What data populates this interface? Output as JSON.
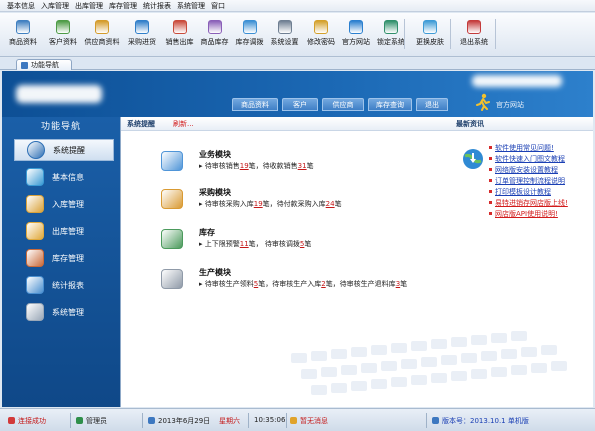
{
  "menubar": {
    "items": [
      "基本信息",
      "入库管理",
      "出库管理",
      "库存管理",
      "统计报表",
      "系统管理",
      "窗口"
    ]
  },
  "toolbar": {
    "buttons": [
      {
        "label": "商品资料",
        "icon": "goods-icon",
        "color": "#3f7fc0"
      },
      {
        "label": "客户资料",
        "icon": "customer-icon",
        "color": "#4d9b45"
      },
      {
        "label": "供应商资料",
        "icon": "supplier-icon",
        "color": "#d49b2a"
      },
      {
        "label": "采购进货",
        "icon": "purchase-icon",
        "color": "#2f7ec9"
      },
      {
        "label": "销售出库",
        "icon": "sales-icon",
        "color": "#c94a3a"
      },
      {
        "label": "商品库存",
        "icon": "inventory-icon",
        "color": "#8a5fb8"
      },
      {
        "label": "库存调拨",
        "icon": "transfer-icon",
        "color": "#3b8fd4"
      },
      {
        "label": "系统设置",
        "icon": "settings-icon",
        "color": "#6f7f92"
      },
      {
        "label": "修改密码",
        "icon": "password-icon",
        "color": "#d4a02a"
      },
      {
        "label": "官方网站",
        "icon": "website-icon",
        "color": "#2a7fcf"
      },
      {
        "label": "锁定系统",
        "icon": "lock-icon",
        "color": "#2f8f6a"
      },
      {
        "label": "更换皮肤",
        "icon": "skin-icon",
        "color": "#3e9bd6"
      },
      {
        "label": "退出系统",
        "icon": "exit-icon",
        "color": "#c43b3b"
      }
    ]
  },
  "tabstrip": {
    "tab_label": "功能导航"
  },
  "header": {
    "nav": [
      "商品资料",
      "客户",
      "供应商",
      "库存查询",
      "退出"
    ],
    "website_label": "官方网站"
  },
  "sidebar": {
    "title": "功能导航",
    "items": [
      {
        "label": "系统提醒",
        "icon": "info-icon",
        "color": "#2d6fb5",
        "active": true
      },
      {
        "label": "基本信息",
        "icon": "blocks-icon",
        "color": "#3a9ad4"
      },
      {
        "label": "入库管理",
        "icon": "box-in-icon",
        "color": "#d9a23a"
      },
      {
        "label": "出库管理",
        "icon": "box-out-icon",
        "color": "#e0a93c"
      },
      {
        "label": "库存管理",
        "icon": "warehouse-icon",
        "color": "#c96a3a"
      },
      {
        "label": "统计报表",
        "icon": "report-icon",
        "color": "#4a8fd0"
      },
      {
        "label": "系统管理",
        "icon": "gears-icon",
        "color": "#9aa8b8"
      }
    ]
  },
  "content": {
    "bar_tab": "系统提醒",
    "bar_link": "刷新...",
    "news_title": "最新资讯",
    "modules": [
      {
        "title": "业务模块",
        "icon": "notebook-icon",
        "color": "#4f95d8",
        "parts": [
          {
            "t": "待审核销售"
          },
          {
            "t": "19",
            "n": true
          },
          {
            "t": "笔，待收款销售"
          },
          {
            "t": "31",
            "n": true
          },
          {
            "t": "笔"
          }
        ]
      },
      {
        "title": "采购模块",
        "icon": "cart-icon",
        "color": "#d99a32",
        "parts": [
          {
            "t": "待审核采购入库"
          },
          {
            "t": "19",
            "n": true
          },
          {
            "t": "笔，待付款采购入库"
          },
          {
            "t": "24",
            "n": true
          },
          {
            "t": "笔"
          }
        ]
      },
      {
        "title": "库存",
        "icon": "database-icon",
        "color": "#4b9a5c",
        "parts": [
          {
            "t": "上下限预警"
          },
          {
            "t": "11",
            "n": true
          },
          {
            "t": "笔，  待审核调拨"
          },
          {
            "t": "5",
            "n": true
          },
          {
            "t": "笔"
          }
        ]
      },
      {
        "title": "生产模块",
        "icon": "clipboard-icon",
        "color": "#8f9aa8",
        "parts": [
          {
            "t": "待审核生产领料"
          },
          {
            "t": "5",
            "n": true
          },
          {
            "t": "笔，待审核生产入库"
          },
          {
            "t": "2",
            "n": true
          },
          {
            "t": "笔，待审核生产退料库"
          },
          {
            "t": "3",
            "n": true
          },
          {
            "t": "笔"
          }
        ]
      }
    ],
    "news": [
      {
        "label": "软件使用常见问题!",
        "red": false
      },
      {
        "label": "软件快速入门图文教程",
        "red": false
      },
      {
        "label": "网络版安装设置教程",
        "red": false
      },
      {
        "label": "订单管理控制流程说明",
        "red": false
      },
      {
        "label": "打印模板设计教程",
        "red": false
      },
      {
        "label": "易特进销存网店版上线!",
        "red": true
      },
      {
        "label": "网店版API使用说明!",
        "red": true
      }
    ]
  },
  "statusbar": {
    "connection": "连接成功",
    "user": "管理员",
    "date": "2013年6月29日",
    "weekday": "星期六",
    "time": "10:35:06",
    "message": "暂无消息",
    "version": "版本号：2013.10.1  单机版"
  },
  "colors": {
    "header_blue": "#1b68b4",
    "sidebar_blue": "#134f95",
    "accent_red": "#c41818",
    "link_blue": "#1a3fb4"
  }
}
